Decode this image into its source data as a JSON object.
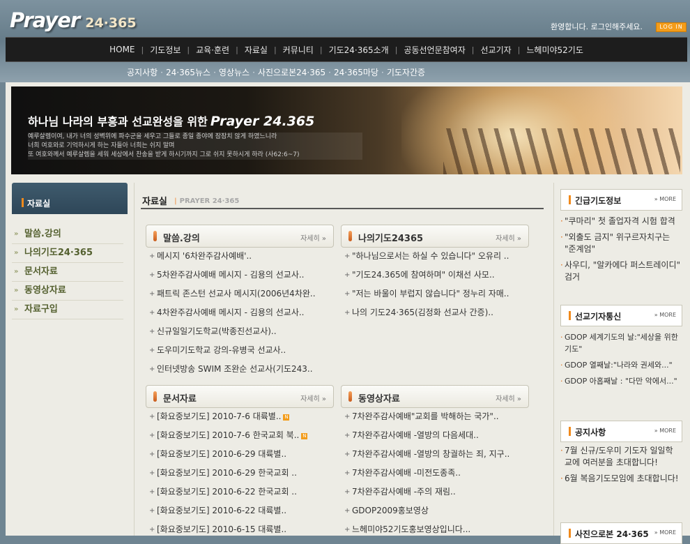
{
  "header": {
    "logo_text": "Prayer",
    "logo_num": "24·365",
    "welcome": "환영합니다. 로그인해주세요.",
    "login_label": "LOG IN"
  },
  "gnb": [
    "HOME",
    "기도정보",
    "교육·훈련",
    "자료실",
    "커뮤니티",
    "기도24·365소개",
    "공동선언문참여자",
    "선교기자",
    "느헤미야52기도"
  ],
  "subnav": [
    "공지사항",
    "24·365뉴스",
    "영상뉴스",
    "사진으로본24·365",
    "24·365마당",
    "기도자간증"
  ],
  "banner": {
    "title_ko": "하나님 나라의 부흥과 선교완성을 위한",
    "title_brand": "Prayer 24.365",
    "verse1": "예루살렘이여, 내가 너의 성벽위에 파수군을 세우고 그들로 종일 종야에 잠잠치 않게 하였느니라",
    "verse2": "너희 여호와로 기억하시게 하는 자들아 너희는 쉬지 말며",
    "verse3": "또 여호와께서 예루살렘을 세워 세상에서 찬송을 받게 하시기까지 그로 쉬지 못하시게 하라 (사62:6~7)"
  },
  "sidebar": {
    "heading": "자료실",
    "items": [
      "말씀.강의",
      "나의기도24·365",
      "문서자료",
      "동영상자료",
      "자료구입"
    ]
  },
  "main": {
    "title": "자료실",
    "subtitle": "PRAYER 24·365",
    "more_label": "자세히",
    "boards": [
      {
        "title": "말씀.강의",
        "posts": [
          "메시지 '6차완주감사예배'..",
          "5차완주감사예배 메시지 - 김용의 선교사..",
          "패트릭 존스턴 선교사 메시지(2006년4차완..",
          "4차완주감사예배 메시지 - 김용의 선교사..",
          "신규일일기도학교(박종진선교사)..",
          "도우미기도학교 강의-유병국 선교사..",
          "인터넷방송 SWIM 조완순 선교사(기도243.."
        ]
      },
      {
        "title": "나의기도24365",
        "posts": [
          "\"하나님으로서는 하실 수 있습니다\" 오유리 ..",
          "\"기도24.365에 참여하며\" 이채선 사모..",
          "\"저는 바울이 부럽지 않습니다\" 정누리 자매..",
          "나의 기도24·365(김정화 선교사 간증).."
        ]
      },
      {
        "title": "문서자료",
        "posts": [
          "[화요중보기도] 2010-7-6 대륙별..",
          "[화요중보기도] 2010-7-6 한국교회 북..",
          "[화요중보기도] 2010-6-29 대륙별..",
          "[화요중보기도] 2010-6-29 한국교회 ..",
          "[화요중보기도] 2010-6-22 한국교회 ..",
          "[화요중보기도] 2010-6-22 대륙별..",
          "[화요중보기도] 2010-6-15 대륙별.."
        ]
      },
      {
        "title": "동영상자료",
        "posts": [
          "7차완주감사예배\"교회를 박해하는 국가\"..",
          "7차완주감사예배 -열방의 다음세대..",
          "7차완주감사예배 -열방의 창궐하는 죄, 지구..",
          "7차완주감사예배 -미전도종족..",
          "7차완주감사예배 -주의 재림..",
          "GDOP2009홍보영상",
          "느헤미야52기도홍보영상입니다..."
        ]
      }
    ],
    "new_badge": "N"
  },
  "right": {
    "more_label": "MORE",
    "boxes": [
      {
        "title": "긴급기도정보",
        "items": [
          "\"쿠마리\" 첫 졸업자격 시험 합격",
          "\"외출도 금지\" 위구르자치구는 \"준계엄\"",
          "사우디, \"알카에다 퍼스트레이디\" 검거"
        ]
      },
      {
        "title": "선교기자통신",
        "items": [
          "GDOP 세계기도의 날:\"세상을 위한 기도\"",
          "GDOP 열째날:\"나라와 권세와...\"",
          "GDOP 아홉째날 : \"다만 악에서...\""
        ]
      },
      {
        "title": "공지사항",
        "items": [
          "7월 신규/도우미 기도자 일일학교에 여러분을 초대합니다!",
          "6월 복음기도모임에 초대합니다!"
        ]
      },
      {
        "title": "사진으로본 24·365",
        "items": []
      }
    ]
  },
  "colors": {
    "accent": "#f08a1c",
    "nav_bg": "#1d1d1d",
    "sidebar_head": "#3f5b6d",
    "frame_bg": "#edece5",
    "side_text": "#54602f"
  },
  "icons": [
    "chevron-right-icon",
    "bullet-icon",
    "new-badge-icon",
    "more-arrow-icon"
  ]
}
